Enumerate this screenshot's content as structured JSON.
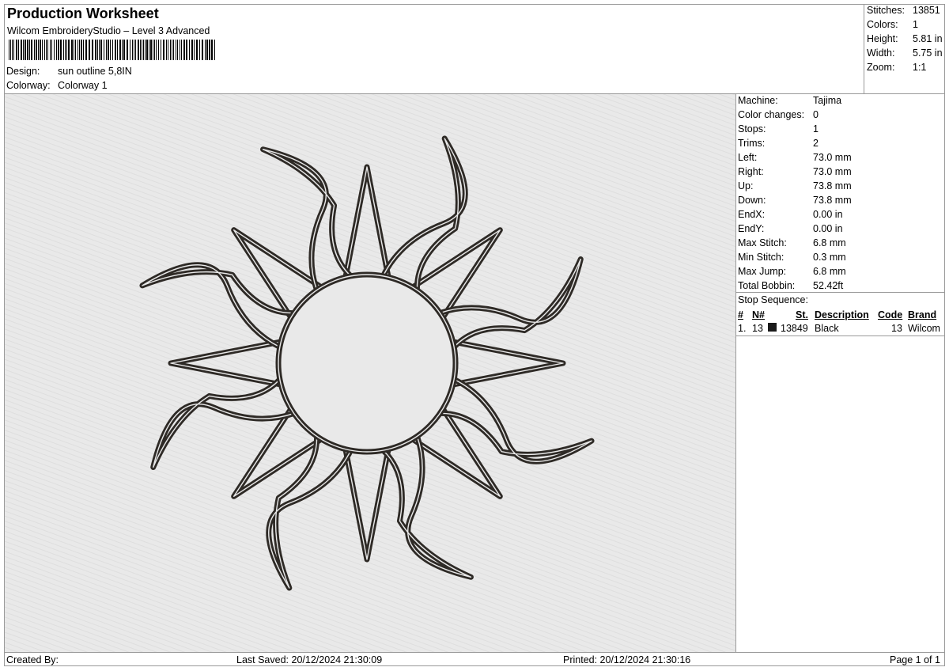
{
  "header": {
    "title": "Production Worksheet",
    "subtitle": "Wilcom EmbroideryStudio – Level 3 Advanced",
    "design_label": "Design:",
    "design_value": "sun outline 5,8IN",
    "colorway_label": "Colorway:",
    "colorway_value": "Colorway 1"
  },
  "summary": [
    {
      "label": "Stitches:",
      "value": "13851"
    },
    {
      "label": "Colors:",
      "value": "1"
    },
    {
      "label": "Height:",
      "value": "5.81 in"
    },
    {
      "label": "Width:",
      "value": "5.75 in"
    },
    {
      "label": "Zoom:",
      "value": "1:1"
    }
  ],
  "details": [
    {
      "label": "Machine:",
      "value": "Tajima"
    },
    {
      "label": "Color changes:",
      "value": "0"
    },
    {
      "label": "Stops:",
      "value": "1"
    },
    {
      "label": "Trims:",
      "value": "2"
    },
    {
      "label": "Left:",
      "value": "73.0 mm"
    },
    {
      "label": "Right:",
      "value": "73.0 mm"
    },
    {
      "label": "Up:",
      "value": "73.8 mm"
    },
    {
      "label": "Down:",
      "value": "73.8 mm"
    },
    {
      "label": "EndX:",
      "value": "0.00 in"
    },
    {
      "label": "EndY:",
      "value": "0.00 in"
    },
    {
      "label": "Max Stitch:",
      "value": "6.8 mm"
    },
    {
      "label": "Min Stitch:",
      "value": "0.3 mm"
    },
    {
      "label": "Max Jump:",
      "value": "6.8 mm"
    },
    {
      "label": "Total Bobbin:",
      "value": "52.42ft"
    }
  ],
  "stop_sequence": {
    "title": "Stop Sequence:",
    "columns": [
      "#",
      "N#",
      "St.",
      "Description",
      "Code",
      "Brand"
    ],
    "rows": [
      {
        "index": "1.",
        "n": "13",
        "stitches": "13849",
        "description": "Black",
        "code": "13",
        "brand": "Wilcom",
        "color": "#1a1a1a"
      }
    ]
  },
  "footer": {
    "created_by": "Created By:",
    "last_saved": "Last Saved: 20/12/2024 21:30:09",
    "printed": "Printed: 20/12/2024 21:30:16",
    "page": "Page 1 of 1"
  },
  "design": {
    "thread_color": "#2e2a26",
    "background_color": "#e9e9e9"
  }
}
